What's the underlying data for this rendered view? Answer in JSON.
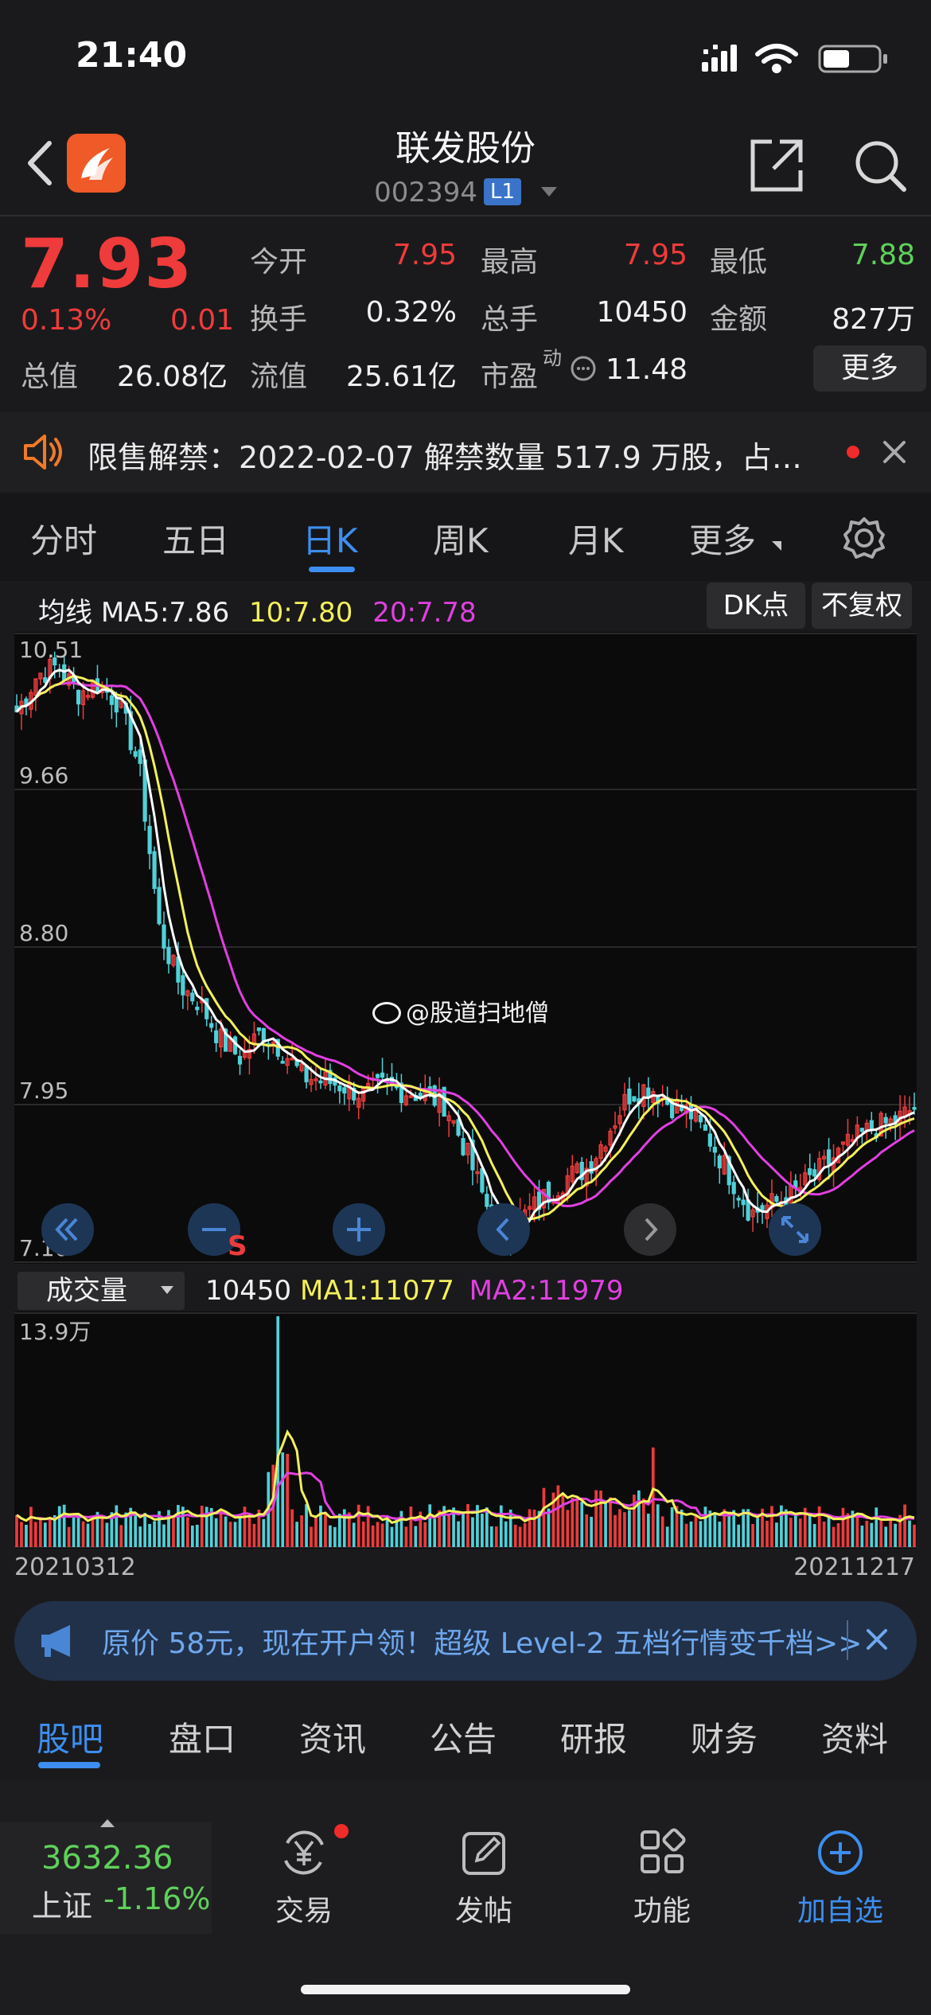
{
  "status": {
    "time": "21:40"
  },
  "header": {
    "title": "联发股份",
    "code": "002394",
    "level": "L1"
  },
  "quote": {
    "price": "7.93",
    "change_pct": "0.13%",
    "change": "0.01",
    "open_label": "今开",
    "open": "7.95",
    "high_label": "最高",
    "high": "7.95",
    "low_label": "最低",
    "low": "7.88",
    "turnover_label": "换手",
    "turnover": "0.32%",
    "volume_label": "总手",
    "volume": "10450",
    "amount_label": "金额",
    "amount": "827万",
    "mktcap_label": "总值",
    "mktcap": "26.08亿",
    "float_label": "流值",
    "float_cap": "25.61亿",
    "pe_label": "市盈",
    "pe_sup": "动",
    "pe": "11.48",
    "more": "更多"
  },
  "notice": {
    "text": "限售解禁：2022-02-07 解禁数量 517.9 万股，占…"
  },
  "period_tabs": [
    "分时",
    "五日",
    "日K",
    "周K",
    "月K",
    "更多"
  ],
  "ma": {
    "label": "均线",
    "ma5": "MA5:7.86",
    "ma10": "10:7.80",
    "ma20": "20:7.78"
  },
  "chips": {
    "dk": "DK点",
    "adj": "不复权"
  },
  "kline_labels": {
    "top": "10.51",
    "l2": "9.66",
    "l3": "8.80",
    "l4": "7.95",
    "bottom": "7.10"
  },
  "watermark": "@股道扫地僧",
  "s_marker": "S",
  "volume": {
    "select_label": "成交量",
    "value": "10450",
    "ma1": "MA1:11077",
    "ma2": "MA2:11979",
    "max_label": "13.9万",
    "start_date": "20210312",
    "end_date": "20211217"
  },
  "ad": {
    "text": "原价 58元，现在开户领！超级 Level-2 五档行情变千档>>"
  },
  "bottom_tabs": [
    "股吧",
    "盘口",
    "资讯",
    "公告",
    "研报",
    "财务",
    "资料"
  ],
  "index": {
    "value": "3632.36",
    "name": "上证",
    "change": "-1.16%"
  },
  "nav": {
    "trade": "交易",
    "post": "发帖",
    "functions": "功能",
    "add": "加自选"
  },
  "colors": {
    "up": "#ef3b3b",
    "down": "#4fd1d9",
    "ma5": "#ffffff",
    "ma10": "#f4f05a",
    "ma20": "#e040e0",
    "accent": "#3d8ef0"
  },
  "chart_data": {
    "type": "candlestick",
    "price_axis": [
      7.1,
      7.95,
      8.8,
      9.66,
      10.51
    ],
    "ylim": [
      7.1,
      10.51
    ],
    "x_start": "20210312",
    "x_end": "20211217",
    "close_trend": [
      10.1,
      10.3,
      10.35,
      10.2,
      10.25,
      10.15,
      9.8,
      8.9,
      8.6,
      8.5,
      8.3,
      8.2,
      8.35,
      8.25,
      8.1,
      8.08,
      8.05,
      8.0,
      8.05,
      8.02,
      8.0,
      7.95,
      7.7,
      7.4,
      7.25,
      7.35,
      7.45,
      7.55,
      7.6,
      7.8,
      8.0,
      8.05,
      7.95,
      7.9,
      7.75,
      7.55,
      7.35,
      7.4,
      7.45,
      7.55,
      7.65,
      7.75,
      7.82,
      7.85,
      7.93
    ],
    "volume_max": 139000
  }
}
